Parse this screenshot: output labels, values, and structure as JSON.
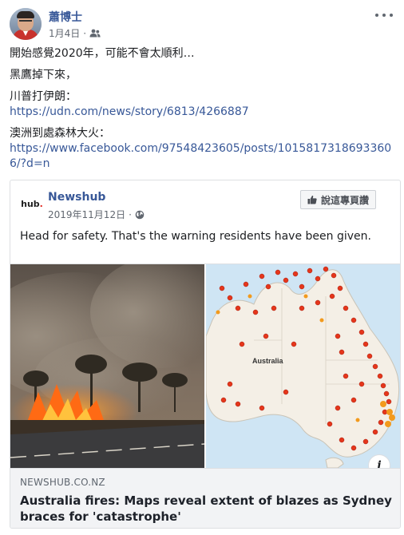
{
  "post": {
    "author": "蕭博士",
    "date": "1月4日",
    "audience_icon": "friends-icon",
    "more_icon": "more-options-icon",
    "paragraphs": [
      "開始感覺2020年，可能不會太順利…",
      "黑鷹掉下來，"
    ],
    "link_items": [
      {
        "label": "川普打伊朗：",
        "url": "https://udn.com/news/story/6813/4266887"
      },
      {
        "label": "澳洲到處森林大火：",
        "url": "https://www.facebook.com/97548423605/posts/10158173186933606/?d=n"
      }
    ]
  },
  "shared": {
    "source_name": "Newshub",
    "logo_text": "hub",
    "logo_dot": ".",
    "date": "2019年11月12日",
    "dot": "·",
    "audience_icon": "globe-icon",
    "like_button": "說這專頁讚",
    "message": "Head for safety. That's the warning residents have been given.",
    "map_label": "Australia",
    "link": {
      "domain": "NEWSHUB.CO.NZ",
      "title": "Australia fires: Maps reveal extent of blazes as Sydney braces for 'catastrophe'",
      "info_icon": "i"
    }
  },
  "colors": {
    "link": "#385898",
    "text": "#1c1e21",
    "meta": "#616770",
    "fire": "#e5361b",
    "map_land": "#f4efe6",
    "map_sea": "#cfe5f4"
  }
}
